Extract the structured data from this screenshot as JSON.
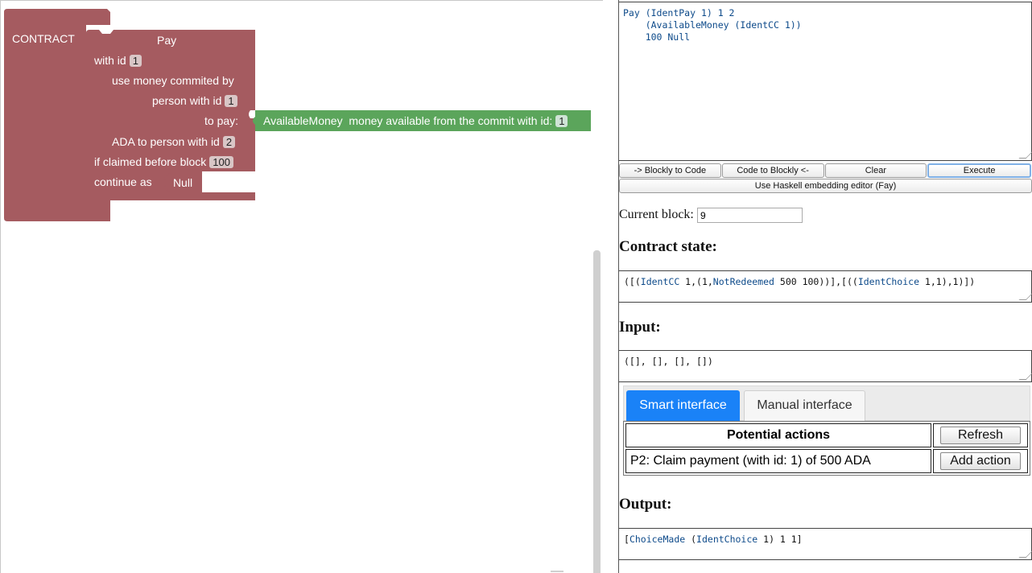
{
  "workspace": {
    "contract_label": "CONTRACT",
    "pay_block": {
      "title": "Pay",
      "with_id": "with id",
      "with_id_value": "1",
      "use_money": "use money commited by",
      "person_with_id": "person with id",
      "person_with_id_value": "1",
      "to_pay": "to pay:",
      "ada_to_person": "ADA to person with id",
      "ada_to_person_value": "2",
      "if_claimed": "if claimed before block",
      "if_claimed_value": "100",
      "continue_as": "continue as",
      "null_label": "Null"
    },
    "available_money_block": {
      "title": "AvailableMoney",
      "description": "money available from the commit with id:",
      "value": "1"
    },
    "colors": {
      "contract_block": "#a55b60",
      "available_money_block": "#5ba55b"
    }
  },
  "editor": {
    "code_line1_a": "Pay (",
    "code_line1_b": "IdentPay",
    "code_line1_c": " 1) 1 2",
    "code_line2_a": "    (",
    "code_line2_b": "AvailableMoney",
    "code_line2_c": " (",
    "code_line2_d": "IdentCC",
    "code_line2_e": " 1))",
    "code_line3": "    100 Null"
  },
  "buttons": {
    "blockly_to_code": "-> Blockly to Code",
    "code_to_blockly": "Code to Blockly <-",
    "clear": "Clear",
    "execute": "Execute",
    "haskell": "Use Haskell embedding editor (Fay)"
  },
  "current_block": {
    "label": "Current block:",
    "value": "9"
  },
  "contract_state": {
    "heading": "Contract state:",
    "p1": "([(",
    "p2": "IdentCC",
    "p3": " 1,(1,",
    "p4": "NotRedeemed",
    "p5": " 500 100))],[((",
    "p6": "IdentChoice",
    "p7": " 1,1),1)])"
  },
  "input": {
    "heading": "Input:",
    "value": "([], [], [], [])"
  },
  "tabs": {
    "smart": "Smart interface",
    "manual": "Manual interface"
  },
  "actions": {
    "header": "Potential actions",
    "refresh": "Refresh",
    "row1_text": "P2: Claim payment (with id: 1) of 500 ADA",
    "row1_button": "Add action"
  },
  "output": {
    "heading": "Output:",
    "p1": "[",
    "p2": "ChoiceMade",
    "p3": " (",
    "p4": "IdentChoice",
    "p5": " 1) 1 1]"
  }
}
